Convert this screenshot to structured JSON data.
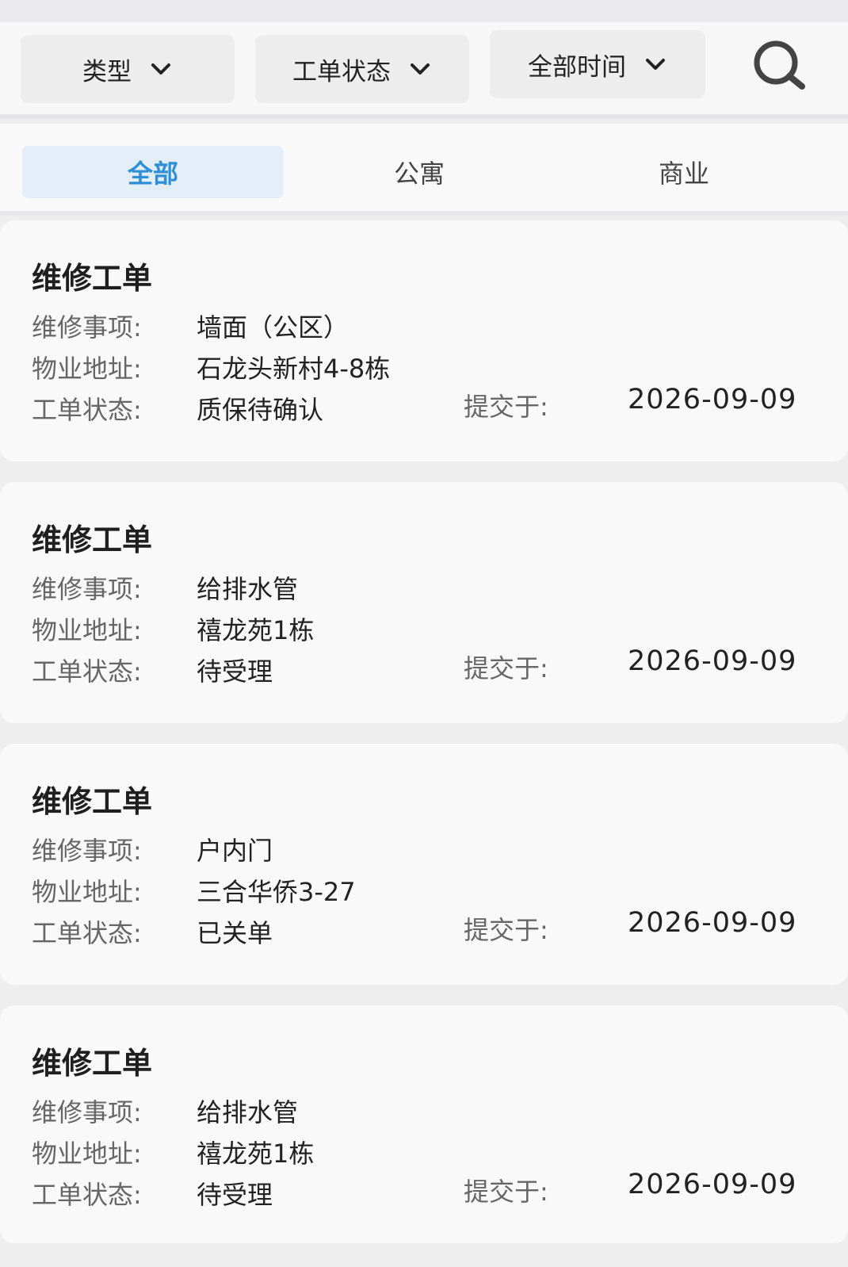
{
  "filters": {
    "type": "类型",
    "status": "工单状态",
    "time": "全部时间"
  },
  "tabs": [
    {
      "label": "全部",
      "active": true
    },
    {
      "label": "公寓",
      "active": false
    },
    {
      "label": "商业",
      "active": false
    }
  ],
  "labels": {
    "item": "维修事项:",
    "address": "物业地址:",
    "status": "工单状态:",
    "submitted": "提交于:"
  },
  "orders": [
    {
      "title": "维修工单",
      "item": "墙面（公区）",
      "address": "石龙头新村4-8栋",
      "status": "质保待确认",
      "date": "2026-09-09"
    },
    {
      "title": "维修工单",
      "item": "给排水管",
      "address": "禧龙苑1栋",
      "status": "待受理",
      "date": "2026-09-09"
    },
    {
      "title": "维修工单",
      "item": "户内门",
      "address": "三合华侨3-27",
      "status": "已关单",
      "date": "2026-09-09"
    },
    {
      "title": "维修工单",
      "item": "给排水管",
      "address": "禧龙苑1栋",
      "status": "待受理",
      "date": "2026-09-09"
    }
  ],
  "colors": {
    "accent": "#2d8fd8",
    "active_tab_bg": "#e3eef9",
    "card_bg": "#f9f9fa",
    "page_bg": "#eeeeef"
  },
  "icons": {
    "dropdown": "chevron-down-icon",
    "search": "search-icon"
  }
}
